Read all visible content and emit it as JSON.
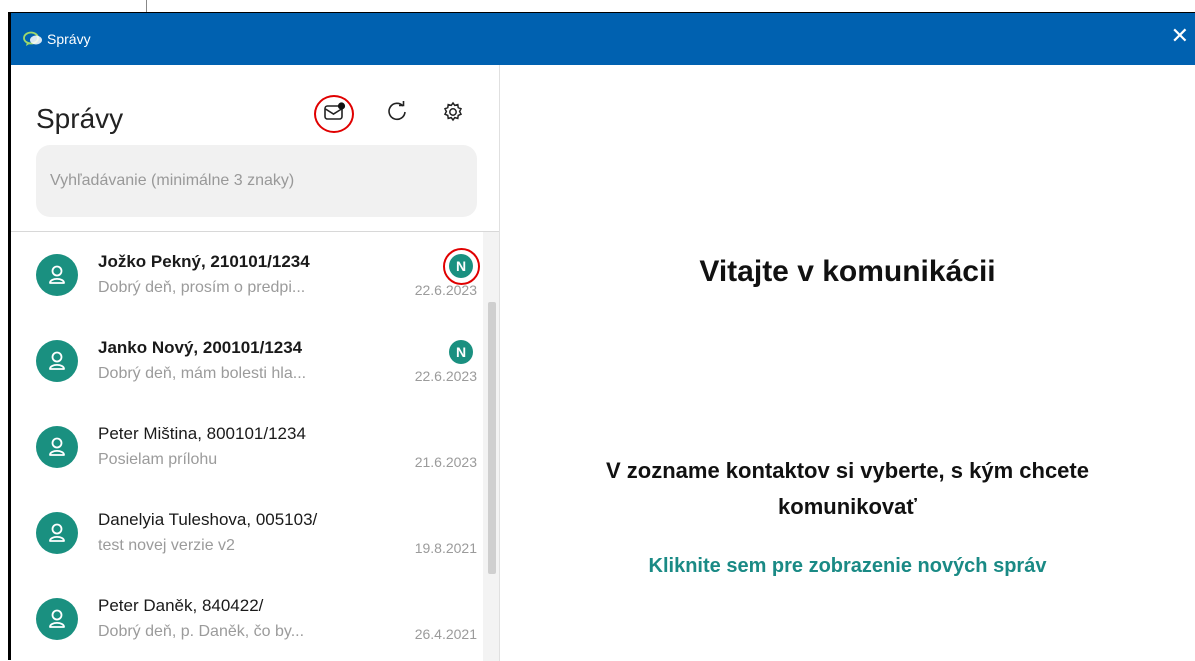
{
  "window": {
    "title": "Správy",
    "close_symbol": "✕"
  },
  "sidebar": {
    "heading": "Správy",
    "toolbar": [
      {
        "name": "new-message-icon"
      },
      {
        "name": "refresh-icon"
      },
      {
        "name": "settings-gear-icon"
      }
    ],
    "search": {
      "placeholder": "Vyhľadávanie (minimálne 3 znaky)",
      "value": ""
    }
  },
  "conversations": [
    {
      "name": "Jožko Pekný, 210101/1234",
      "preview": "Dobrý deň, prosím o predpi...",
      "date": "22.6.2023",
      "unread": true,
      "badge": "N"
    },
    {
      "name": "Janko Nový, 200101/1234",
      "preview": "Dobrý deň, mám bolesti hla...",
      "date": "22.6.2023",
      "unread": true,
      "badge": "N"
    },
    {
      "name": "Peter Miština, 800101/1234",
      "preview": "Posielam prílohu",
      "date": "21.6.2023",
      "unread": false
    },
    {
      "name": "Danelyia Tuleshova, 005103/",
      "preview": "test novej verzie v2",
      "date": "19.8.2021",
      "unread": false
    },
    {
      "name": "Peter Daněk, 840422/",
      "preview": "Dobrý deň, p. Daněk, čo by...",
      "date": "26.4.2021",
      "unread": false
    }
  ],
  "main": {
    "welcome": "Vitajte v komunikácii",
    "choose_contact": "V zozname kontaktov si vyberte, s kým chcete komunikovať",
    "new_messages_link": "Kliknite sem pre zobrazenie nových správ"
  },
  "colors": {
    "titlebar": "#0061b0",
    "accent": "#1a9080",
    "highlight_ring": "#e00000",
    "link": "#1a8a85"
  }
}
